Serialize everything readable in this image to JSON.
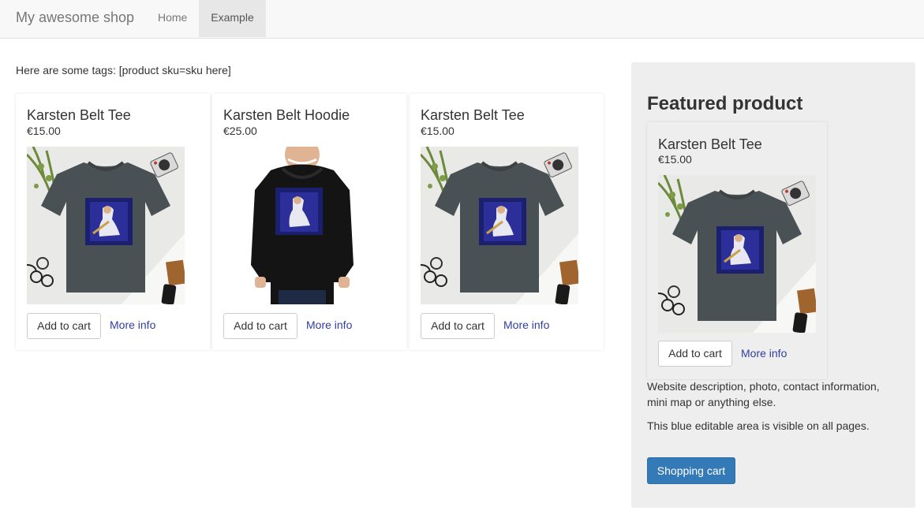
{
  "nav": {
    "brand": "My awesome shop",
    "links": [
      {
        "label": "Home"
      },
      {
        "label": "Example"
      }
    ]
  },
  "intro_text": "Here are some tags: [product sku=sku here]",
  "products": [
    {
      "title": "Karsten Belt Tee",
      "price": "€15.00",
      "image": "tshirt-image",
      "add_label": "Add to cart",
      "info_label": "More info"
    },
    {
      "title": "Karsten Belt Hoodie",
      "price": "€25.00",
      "image": "hoodie-image",
      "add_label": "Add to cart",
      "info_label": "More info"
    },
    {
      "title": "Karsten Belt Tee",
      "price": "€15.00",
      "image": "tshirt-image",
      "add_label": "Add to cart",
      "info_label": "More info"
    }
  ],
  "sidebar": {
    "heading": "Featured product",
    "featured": {
      "title": "Karsten Belt Tee",
      "price": "€15.00",
      "image": "tshirt-image",
      "add_label": "Add to cart",
      "info_label": "More info"
    },
    "description": "Website description, photo, contact information, mini map or anything else.",
    "note": "This blue editable area is visible on all pages.",
    "cart_button": "Shopping cart"
  },
  "colors": {
    "primary": "#337ab7",
    "link": "#303f9f",
    "sidebar_bg": "#eeeeee",
    "navbar_bg": "#f8f8f8"
  }
}
